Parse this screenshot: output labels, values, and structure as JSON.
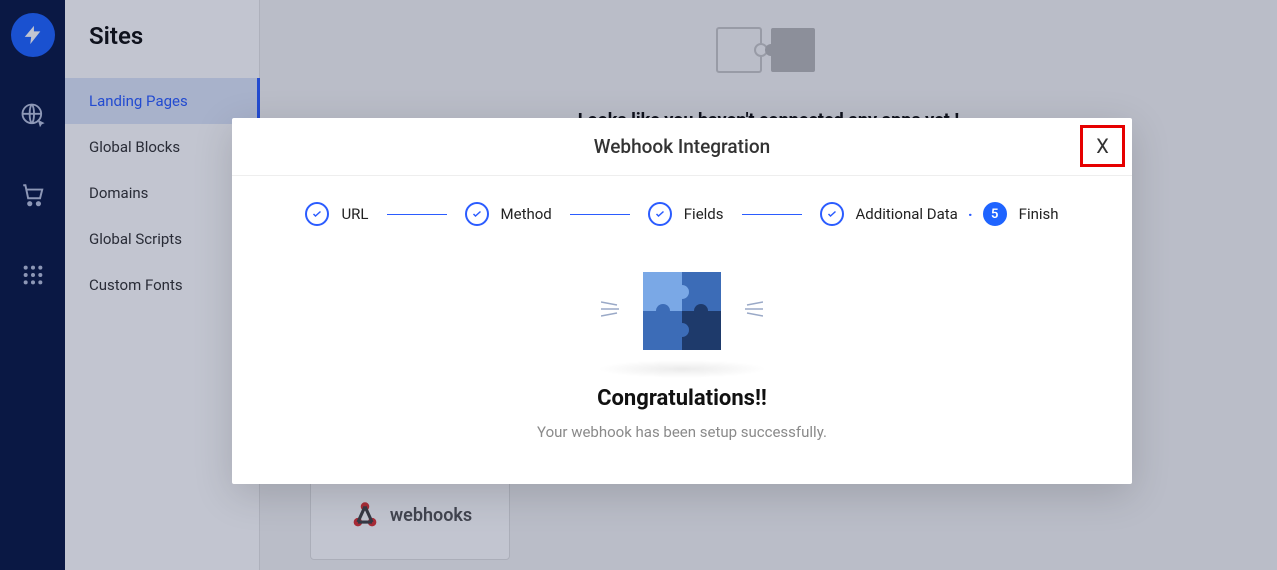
{
  "sidebar": {
    "title": "Sites",
    "items": [
      {
        "label": "Landing Pages",
        "active": true
      },
      {
        "label": "Global Blocks"
      },
      {
        "label": "Domains"
      },
      {
        "label": "Global Scripts"
      },
      {
        "label": "Custom Fonts"
      }
    ]
  },
  "main": {
    "message": "Looks like you haven't connected any apps yet !",
    "card_label": "webhooks"
  },
  "modal": {
    "title": "Webhook Integration",
    "close_glyph": "X",
    "steps": [
      {
        "label": "URL"
      },
      {
        "label": "Method"
      },
      {
        "label": "Fields"
      },
      {
        "label": "Additional Data"
      },
      {
        "label": "Finish",
        "number": "5"
      }
    ],
    "congrats_title": "Congratulations!!",
    "congrats_sub": "Your webhook has been setup successfully."
  }
}
